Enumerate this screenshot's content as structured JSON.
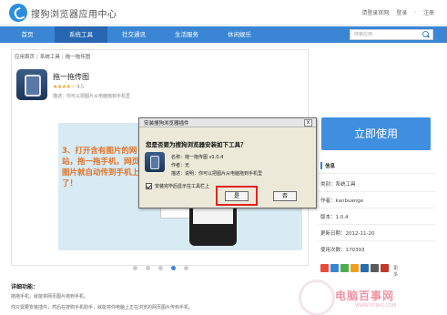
{
  "topbar": {
    "logo_text": "搜狗浏览器应用中心",
    "links": [
      "请登录官网",
      "登录",
      "注册"
    ]
  },
  "nav": {
    "items": [
      "首页",
      "系统工具",
      "社交通讯",
      "生活服务",
      "休闲娱乐"
    ],
    "active_index": 1,
    "search_placeholder": "搜索应用"
  },
  "breadcrumb": [
    "应用首页",
    "系统工具",
    "拖一拖传图"
  ],
  "app": {
    "title": "拖一拖传图",
    "stars": "★★★★☆",
    "rating": "4.5",
    "description": "描述：你可以把图片从电脑拖到手机里"
  },
  "banner": {
    "text": "3、打开含有图片的网站，拖一拖手机，网页图片就自动传到手机上了！",
    "pages": 5,
    "active_page": 3
  },
  "install_button": "立即使用",
  "sidebar": {
    "heading": "信息",
    "fields": [
      {
        "label": "类别：系统工具"
      },
      {
        "label": "作者：kanbuange"
      },
      {
        "label": "版本：1.0.4"
      },
      {
        "label": "更新日期：2012-11-20"
      },
      {
        "label": "使用次数：170393"
      }
    ],
    "share_more": "更多"
  },
  "details": {
    "title": "详细功能：",
    "lines": [
      "拖拖手机，就能将网页图片拖到手机。",
      "你只需要安装插件，然后在搜狗手机助手，就能将你电脑上正在浏览的网页图片传到手机。"
    ]
  },
  "dialog": {
    "title": "安装搜狗浏览器插件",
    "close_label": "x",
    "question": "您是否要为搜狗浏览器安装如下工具？",
    "fields": [
      "名称：拖一拖传图 v1.0.4",
      "作者：无",
      "描述：说明：你可以把图片从电脑拖到手机里"
    ],
    "checkbox_label": "安装完毕后显示在工具栏上",
    "checkbox_checked": true,
    "ok_label": "是",
    "cancel_label": "否",
    "highlight_color": "#e0241f"
  },
  "watermark": {
    "text": "电脑百事网",
    "url": "WWW.PC841.COM"
  },
  "colors": {
    "nav_bg": "#3a86d4",
    "nav_active": "#2767b2",
    "install_bg": "#3f8ee0",
    "banner_text": "#e2742a"
  }
}
